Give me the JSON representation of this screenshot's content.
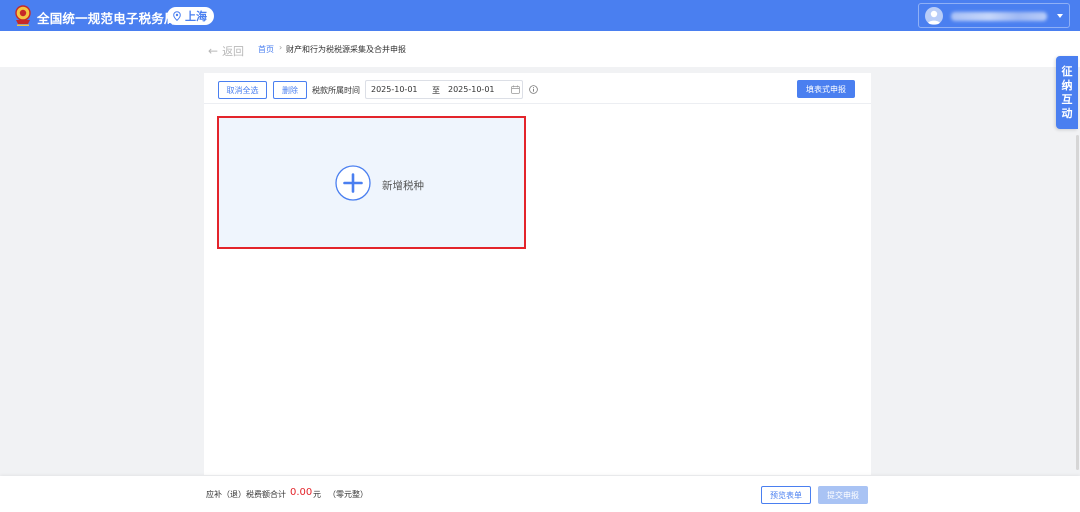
{
  "header": {
    "site_title": "全国统一规范电子税务局",
    "region": "上海"
  },
  "breadcrumb": {
    "back": "返回",
    "home": "首页",
    "separator": "›",
    "current": "财产和行为税税源采集及合并申报"
  },
  "toolbar": {
    "cancel_select_all": "取消全选",
    "delete": "删除",
    "period_label": "税款所属时间",
    "date_from": "2025-10-01",
    "date_to_label": "至",
    "date_to": "2025-10-01",
    "fill_form_declare": "填表式申报"
  },
  "add_card": {
    "label": "新增税种"
  },
  "footer": {
    "total_label": "应补（退）税费额合计",
    "total_amount": "0.00",
    "currency_unit": "元",
    "amount_in_words": "（零元整）",
    "preview_form": "预览表单",
    "submit_declaration": "提交申报"
  },
  "side_tab": {
    "chars": [
      "征",
      "纳",
      "互",
      "动"
    ]
  },
  "colors": {
    "brand_blue": "#4a7ff0",
    "highlight_red": "#e3242b",
    "card_bg": "#eff5fd",
    "disabled_blue": "#a9c3f4"
  },
  "icons": {
    "emblem": "tax-emblem-icon",
    "pin": "location-pin-icon",
    "avatar": "user-avatar-icon",
    "caret": "caret-down-icon",
    "back": "arrow-left-icon",
    "calendar": "calendar-icon",
    "info": "info-circle-icon",
    "plus": "plus-circle-icon"
  }
}
